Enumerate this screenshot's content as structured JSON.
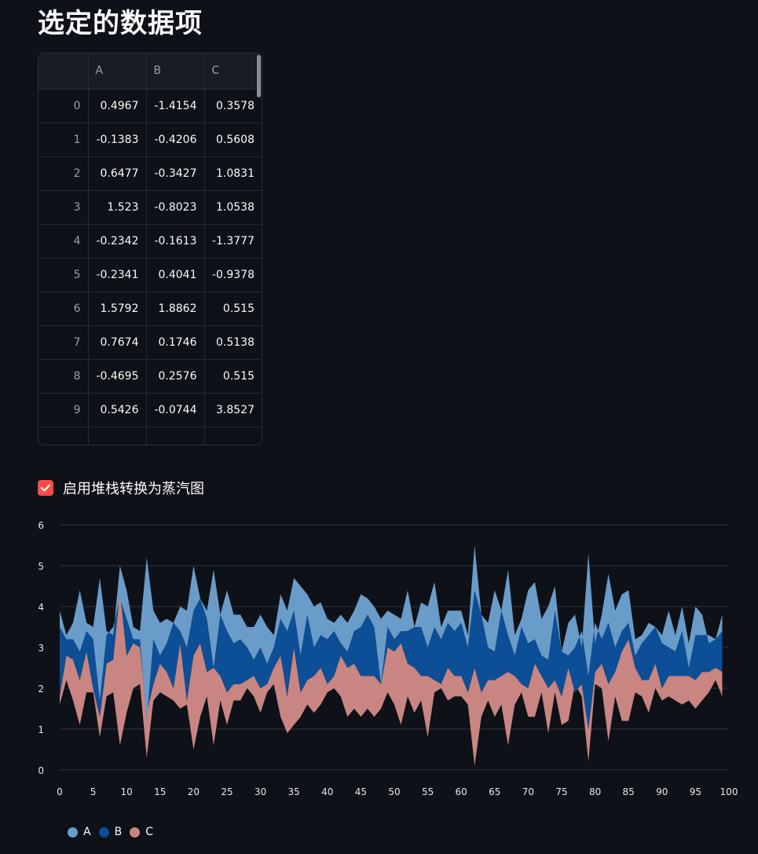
{
  "page": {
    "title": "选定的数据项"
  },
  "table": {
    "columns": [
      "",
      "A",
      "B",
      "C"
    ],
    "rows": [
      [
        "0",
        "0.4967",
        "-1.4154",
        "0.3578"
      ],
      [
        "1",
        "-0.1383",
        "-0.4206",
        "0.5608"
      ],
      [
        "2",
        "0.6477",
        "-0.3427",
        "1.0831"
      ],
      [
        "3",
        "1.523",
        "-0.8023",
        "1.0538"
      ],
      [
        "4",
        "-0.2342",
        "-0.1613",
        "-1.3777"
      ],
      [
        "5",
        "-0.2341",
        "0.4041",
        "-0.9378"
      ],
      [
        "6",
        "1.5792",
        "1.8862",
        "0.515"
      ],
      [
        "7",
        "0.7674",
        "0.1746",
        "0.5138"
      ],
      [
        "8",
        "-0.4695",
        "0.2576",
        "0.515"
      ],
      [
        "9",
        "0.5426",
        "-0.0744",
        "3.8527"
      ]
    ]
  },
  "checkbox": {
    "label": "启用堆栈转换为蒸汽图",
    "checked": true
  },
  "chart_data": {
    "type": "area",
    "stack": "streamgraph",
    "x": [
      0,
      1,
      2,
      3,
      4,
      5,
      6,
      7,
      8,
      9,
      10,
      11,
      12,
      13,
      14,
      15,
      16,
      17,
      18,
      19,
      20,
      21,
      22,
      23,
      24,
      25,
      26,
      27,
      28,
      29,
      30,
      31,
      32,
      33,
      34,
      35,
      36,
      37,
      38,
      39,
      40,
      41,
      42,
      43,
      44,
      45,
      46,
      47,
      48,
      49,
      50,
      51,
      52,
      53,
      54,
      55,
      56,
      57,
      58,
      59,
      60,
      61,
      62,
      63,
      64,
      65,
      66,
      67,
      68,
      69,
      70,
      71,
      72,
      73,
      74,
      75,
      76,
      77,
      78,
      79,
      80,
      81,
      82,
      83,
      84,
      85,
      86,
      87,
      88,
      89,
      90,
      91,
      92,
      93,
      94,
      95,
      96,
      97,
      98,
      99
    ],
    "xticks": [
      "0",
      "5",
      "10",
      "15",
      "20",
      "25",
      "30",
      "35",
      "40",
      "45",
      "50",
      "55",
      "60",
      "65",
      "70",
      "75",
      "80",
      "85",
      "90",
      "95",
      "100"
    ],
    "xlim": [
      0,
      100
    ],
    "yticks": [
      "0",
      "1",
      "2",
      "3",
      "4",
      "5",
      "6"
    ],
    "ylim": [
      0,
      6
    ],
    "grid": true,
    "legend": "bottom-left",
    "series": [
      {
        "name": "A",
        "color": "#6a9cc9",
        "lower": [
          3.5,
          3.2,
          3.2,
          2.9,
          3.4,
          3.2,
          1.7,
          3.3,
          3.5,
          4.2,
          3.7,
          3.2,
          3.2,
          1.2,
          3.2,
          2.8,
          3.1,
          3.6,
          3.4,
          3.0,
          3.9,
          4.2,
          3.7,
          2.5,
          3.8,
          3.4,
          3.1,
          3.2,
          3.0,
          2.7,
          3.0,
          2.6,
          3.0,
          3.7,
          3.4,
          3.9,
          2.8,
          3.8,
          3.0,
          3.3,
          3.2,
          3.4,
          3.1,
          2.9,
          3.4,
          3.5,
          3.8,
          3.5,
          2.1,
          3.5,
          3.2,
          3.4,
          3.4,
          3.5,
          3.5,
          3.0,
          3.5,
          3.2,
          3.6,
          3.4,
          3.6,
          3.0,
          4.4,
          3.8,
          3.0,
          2.9,
          3.9,
          3.3,
          2.8,
          3.5,
          3.1,
          3.2,
          2.8,
          2.7,
          3.9,
          2.9,
          2.8,
          3.0,
          3.4,
          2.3,
          3.6,
          3.2,
          3.6,
          3.0,
          3.4,
          3.6,
          2.8,
          3.1,
          3.3,
          3.5,
          3.1,
          3.0,
          2.9,
          3.4,
          2.5,
          3.3,
          3.3,
          3.3,
          3.2,
          3.4
        ],
        "upper": [
          3.9,
          3.3,
          3.6,
          4.4,
          3.6,
          3.5,
          4.7,
          3.4,
          3.3,
          5.0,
          4.4,
          3.5,
          3.4,
          5.2,
          3.9,
          3.6,
          3.7,
          3.6,
          4.0,
          3.9,
          5.0,
          4.2,
          3.9,
          4.9,
          3.8,
          4.4,
          3.8,
          3.8,
          3.5,
          3.5,
          3.8,
          3.5,
          3.3,
          4.3,
          3.9,
          4.7,
          4.5,
          4.3,
          4.0,
          4.1,
          3.7,
          3.6,
          3.8,
          3.6,
          3.9,
          4.3,
          4.2,
          4.0,
          3.7,
          3.9,
          3.8,
          3.7,
          4.4,
          3.5,
          4.1,
          4.0,
          4.6,
          3.5,
          3.9,
          3.9,
          3.9,
          3.3,
          5.5,
          3.8,
          3.6,
          4.4,
          3.9,
          4.9,
          3.3,
          3.7,
          4.4,
          4.6,
          3.7,
          4.0,
          4.5,
          2.9,
          3.6,
          3.8,
          3.0,
          5.3,
          3.1,
          3.8,
          4.8,
          3.9,
          4.3,
          4.4,
          3.2,
          3.3,
          3.6,
          3.5,
          3.3,
          3.9,
          3.3,
          4.0,
          3.1,
          4.0,
          3.8,
          3.1,
          3.2,
          3.8
        ]
      },
      {
        "name": "B",
        "color": "#0d4f96",
        "lower": [
          1.8,
          2.8,
          2.7,
          2.2,
          2.9,
          2.0,
          1.3,
          2.6,
          2.7,
          4.4,
          2.8,
          3.1,
          3.0,
          1.4,
          2.1,
          2.6,
          2.4,
          2.0,
          3.1,
          1.7,
          2.8,
          3.1,
          2.4,
          2.5,
          2.3,
          1.9,
          2.1,
          2.1,
          2.2,
          2.3,
          2.0,
          2.1,
          2.5,
          2.8,
          1.8,
          3.0,
          1.9,
          2.2,
          2.3,
          2.5,
          2.1,
          2.3,
          2.8,
          2.5,
          2.6,
          2.3,
          2.3,
          2.3,
          2.1,
          3.0,
          2.9,
          3.1,
          2.6,
          2.5,
          2.3,
          2.3,
          2.2,
          2.1,
          2.5,
          2.3,
          2.3,
          1.9,
          2.5,
          1.9,
          2.2,
          2.2,
          2.3,
          2.4,
          2.3,
          2.1,
          2.0,
          2.6,
          2.3,
          2.0,
          2.2,
          1.8,
          2.5,
          1.9,
          2.1,
          1.0,
          2.4,
          2.6,
          2.1,
          2.4,
          2.9,
          3.2,
          2.5,
          2.2,
          2.2,
          2.6,
          2.0,
          2.3,
          2.3,
          2.3,
          2.3,
          2.2,
          2.4,
          2.4,
          2.5,
          2.4
        ],
        "upper": [
          3.5,
          3.2,
          3.2,
          2.9,
          3.4,
          3.2,
          1.7,
          3.3,
          3.5,
          4.2,
          3.7,
          3.2,
          3.2,
          1.2,
          3.2,
          2.8,
          3.1,
          3.6,
          3.4,
          3.0,
          3.9,
          4.2,
          3.7,
          2.5,
          3.8,
          3.4,
          3.1,
          3.2,
          3.0,
          2.7,
          3.0,
          2.6,
          3.0,
          3.7,
          3.4,
          3.9,
          2.8,
          3.8,
          3.0,
          3.3,
          3.2,
          3.4,
          3.1,
          2.9,
          3.4,
          3.5,
          3.8,
          3.5,
          2.1,
          3.5,
          3.2,
          3.4,
          3.4,
          3.5,
          3.5,
          3.0,
          3.5,
          3.2,
          3.6,
          3.4,
          3.6,
          3.0,
          4.4,
          3.8,
          3.0,
          2.9,
          3.9,
          3.3,
          2.8,
          3.5,
          3.1,
          3.2,
          2.8,
          2.7,
          3.9,
          2.9,
          2.8,
          3.0,
          3.4,
          2.3,
          3.6,
          3.2,
          3.6,
          3.0,
          3.4,
          3.6,
          2.8,
          3.1,
          3.3,
          3.5,
          3.1,
          3.0,
          2.9,
          3.4,
          2.5,
          3.3,
          3.3,
          3.3,
          3.2,
          3.4
        ]
      },
      {
        "name": "C",
        "color": "#c88581",
        "lower": [
          1.6,
          2.2,
          1.7,
          1.1,
          1.9,
          1.9,
          0.8,
          1.8,
          1.9,
          0.6,
          1.4,
          2.0,
          2.1,
          0.3,
          1.7,
          1.9,
          1.8,
          1.7,
          1.5,
          1.6,
          0.5,
          1.3,
          1.8,
          0.6,
          1.7,
          1.1,
          1.7,
          1.7,
          2.0,
          1.8,
          1.4,
          1.9,
          2.1,
          1.3,
          0.9,
          1.1,
          1.3,
          1.6,
          1.4,
          1.6,
          1.9,
          2.0,
          1.8,
          1.3,
          1.5,
          1.3,
          1.5,
          1.3,
          1.5,
          1.9,
          1.6,
          1.1,
          1.8,
          1.4,
          1.7,
          0.8,
          1.9,
          2.0,
          1.7,
          1.8,
          1.8,
          1.6,
          0.1,
          1.3,
          1.7,
          1.3,
          1.6,
          0.6,
          1.6,
          1.9,
          1.3,
          1.3,
          1.9,
          0.9,
          1.9,
          1.1,
          1.2,
          2.1,
          1.8,
          0.2,
          2.1,
          2.0,
          0.7,
          1.8,
          1.2,
          1.2,
          1.9,
          1.8,
          1.4,
          2.0,
          1.7,
          1.8,
          1.7,
          1.6,
          1.7,
          1.5,
          1.7,
          1.9,
          2.2,
          1.8
        ],
        "upper": [
          1.8,
          2.8,
          2.7,
          2.2,
          2.9,
          2.0,
          1.3,
          2.6,
          2.7,
          4.4,
          2.8,
          3.1,
          3.0,
          1.4,
          2.1,
          2.6,
          2.4,
          2.0,
          3.1,
          1.7,
          2.8,
          3.1,
          2.4,
          2.5,
          2.3,
          1.9,
          2.1,
          2.1,
          2.2,
          2.3,
          2.0,
          2.1,
          2.5,
          2.8,
          1.8,
          3.0,
          1.9,
          2.2,
          2.3,
          2.5,
          2.1,
          2.3,
          2.8,
          2.5,
          2.6,
          2.3,
          2.3,
          2.3,
          2.1,
          3.0,
          2.9,
          3.1,
          2.6,
          2.5,
          2.3,
          2.3,
          2.2,
          2.1,
          2.5,
          2.3,
          2.3,
          1.9,
          2.5,
          1.9,
          2.2,
          2.2,
          2.3,
          2.4,
          2.3,
          2.1,
          2.0,
          2.6,
          2.3,
          2.0,
          2.2,
          1.8,
          2.5,
          1.9,
          2.1,
          1.0,
          2.4,
          2.6,
          2.1,
          2.4,
          2.9,
          3.2,
          2.5,
          2.2,
          2.2,
          2.6,
          2.0,
          2.3,
          2.3,
          2.3,
          2.3,
          2.2,
          2.4,
          2.4,
          2.5,
          2.4
        ]
      }
    ]
  }
}
